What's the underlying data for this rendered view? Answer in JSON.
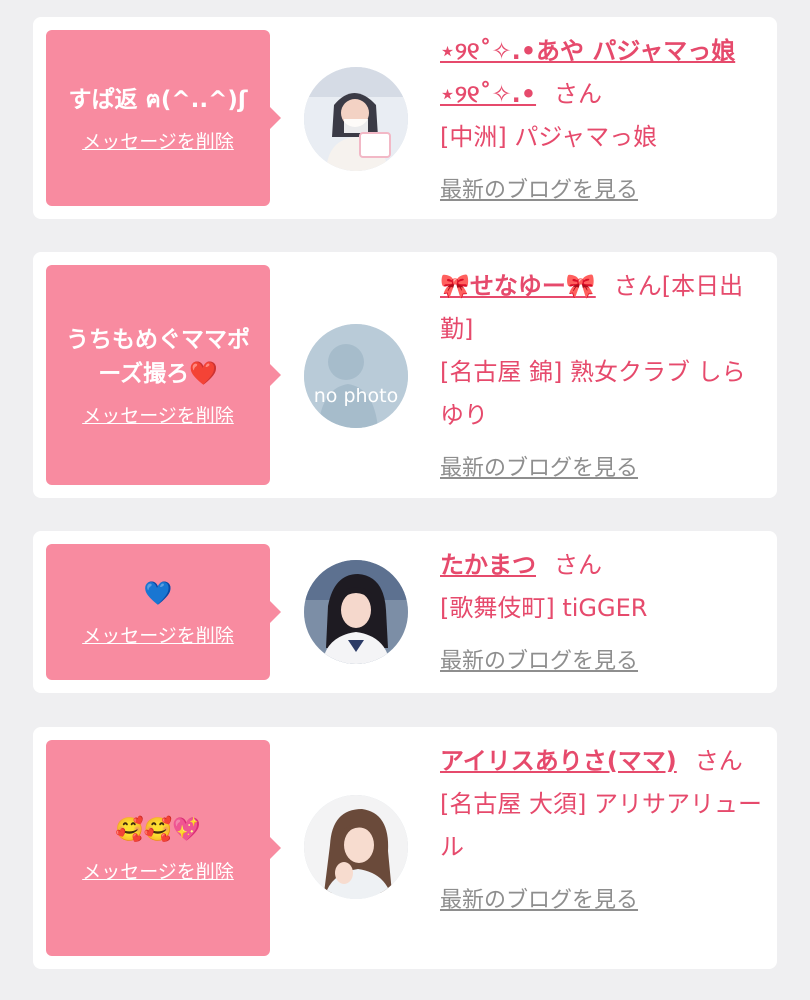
{
  "messages": [
    {
      "message": "すぱ返 ฅ(^..^)ʃ",
      "delete_label": "メッセージを削除",
      "avatar": "girl-photo-pajama-shop",
      "name": "⋆୨୧˚✧.•あや パジャマっ娘 ⋆୨୧˚✧.•",
      "san": "さん",
      "status": "",
      "shop": "[中洲] パジャマっ娘",
      "blog_link": "最新のブログを見る"
    },
    {
      "message": "うちもめぐママポーズ撮ろ❤️",
      "delete_label": "メッセージを削除",
      "avatar": "no-photo",
      "avatar_text": "no photo",
      "name": "🎀せなゆー🎀",
      "san": "さん",
      "status": "[本日出勤]",
      "shop": "[名古屋 錦] 熟女クラブ しらゆり",
      "blog_link": "最新のブログを見る"
    },
    {
      "message": "💙",
      "delete_label": "メッセージを削除",
      "avatar": "girl-photo-dark-hair",
      "name": "たかまつ",
      "san": "さん",
      "status": "",
      "shop": "[歌舞伎町] tiGGER",
      "blog_link": "最新のブログを見る"
    },
    {
      "message": "🥰🥰💖",
      "delete_label": "メッセージを削除",
      "avatar": "girl-photo-long-hair",
      "name": "アイリスありさ(ママ)",
      "san": "さん",
      "status": "",
      "shop": "[名古屋 大須] アリサアリュール",
      "blog_link": "最新のブログを見る"
    }
  ],
  "colors": {
    "page_background": "#efeff1",
    "card_background": "#ffffff",
    "bubble": "#f88ba0",
    "accent_text": "#e64a6c",
    "link_gray": "#8e8e8e"
  }
}
